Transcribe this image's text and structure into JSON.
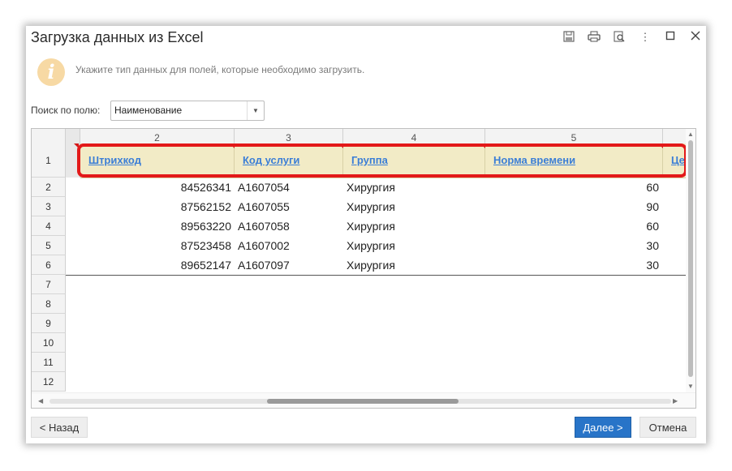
{
  "window": {
    "title": "Загрузка данных из Excel",
    "toolbar_icons": [
      "save-icon",
      "print-icon",
      "preview-icon",
      "more-icon",
      "maximize-icon",
      "close-icon"
    ]
  },
  "info": {
    "icon": "i",
    "text": "Укажите тип данных для полей, которые необходимо загрузить."
  },
  "search": {
    "label": "Поиск по полю:",
    "value": "Наименование"
  },
  "grid": {
    "column_numbers": [
      "2",
      "3",
      "4",
      "5"
    ],
    "header_row_number": "1",
    "headers": [
      "Штрихкод",
      "Код услуги",
      "Группа",
      "Норма времени",
      "Це"
    ],
    "row_numbers": [
      "2",
      "3",
      "4",
      "5",
      "6",
      "7",
      "8",
      "9",
      "10",
      "11",
      "12"
    ],
    "rows": [
      [
        "84526341",
        "A1607054",
        "Хирургия",
        "60"
      ],
      [
        "87562152",
        "A1607055",
        "Хирургия",
        "90"
      ],
      [
        "89563220",
        "A1607058",
        "Хирургия",
        "60"
      ],
      [
        "87523458",
        "A1607002",
        "Хирургия",
        "30"
      ],
      [
        "89652147",
        "A1607097",
        "Хирургия",
        "30"
      ]
    ],
    "highlight_color": "#e31919"
  },
  "buttons": {
    "back": "< Назад",
    "next": "Далее >",
    "cancel": "Отмена"
  }
}
